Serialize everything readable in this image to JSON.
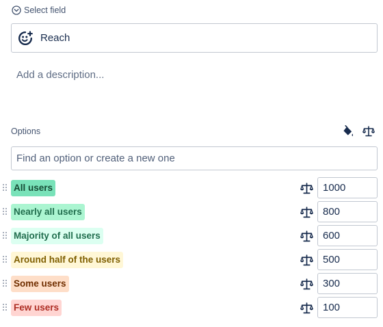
{
  "field": {
    "select_label": "Select field",
    "select_icon": "chevron-down-circle-icon",
    "name_icon": "smiley-icon",
    "name_value": "Reach",
    "description_placeholder": "Add a description..."
  },
  "options": {
    "title": "Options",
    "header_icons": [
      "paint-bucket-icon",
      "scale-icon"
    ],
    "search_placeholder": "Find an option or create a new one",
    "items": [
      {
        "label": "All users",
        "weight": "1000",
        "bg": "#79e2b9",
        "fg": "#164b35"
      },
      {
        "label": "Nearly all users",
        "weight": "800",
        "bg": "#abf5d1",
        "fg": "#216e4e"
      },
      {
        "label": "Majority of all users",
        "weight": "600",
        "bg": "#dcfff1",
        "fg": "#216e4e"
      },
      {
        "label": "Around half of the users",
        "weight": "500",
        "bg": "#fff7d6",
        "fg": "#7f5f01"
      },
      {
        "label": "Some users",
        "weight": "300",
        "bg": "#fedec8",
        "fg": "#702e00"
      },
      {
        "label": "Few users",
        "weight": "100",
        "bg": "#ffd5d2",
        "fg": "#ae2e24"
      }
    ]
  }
}
